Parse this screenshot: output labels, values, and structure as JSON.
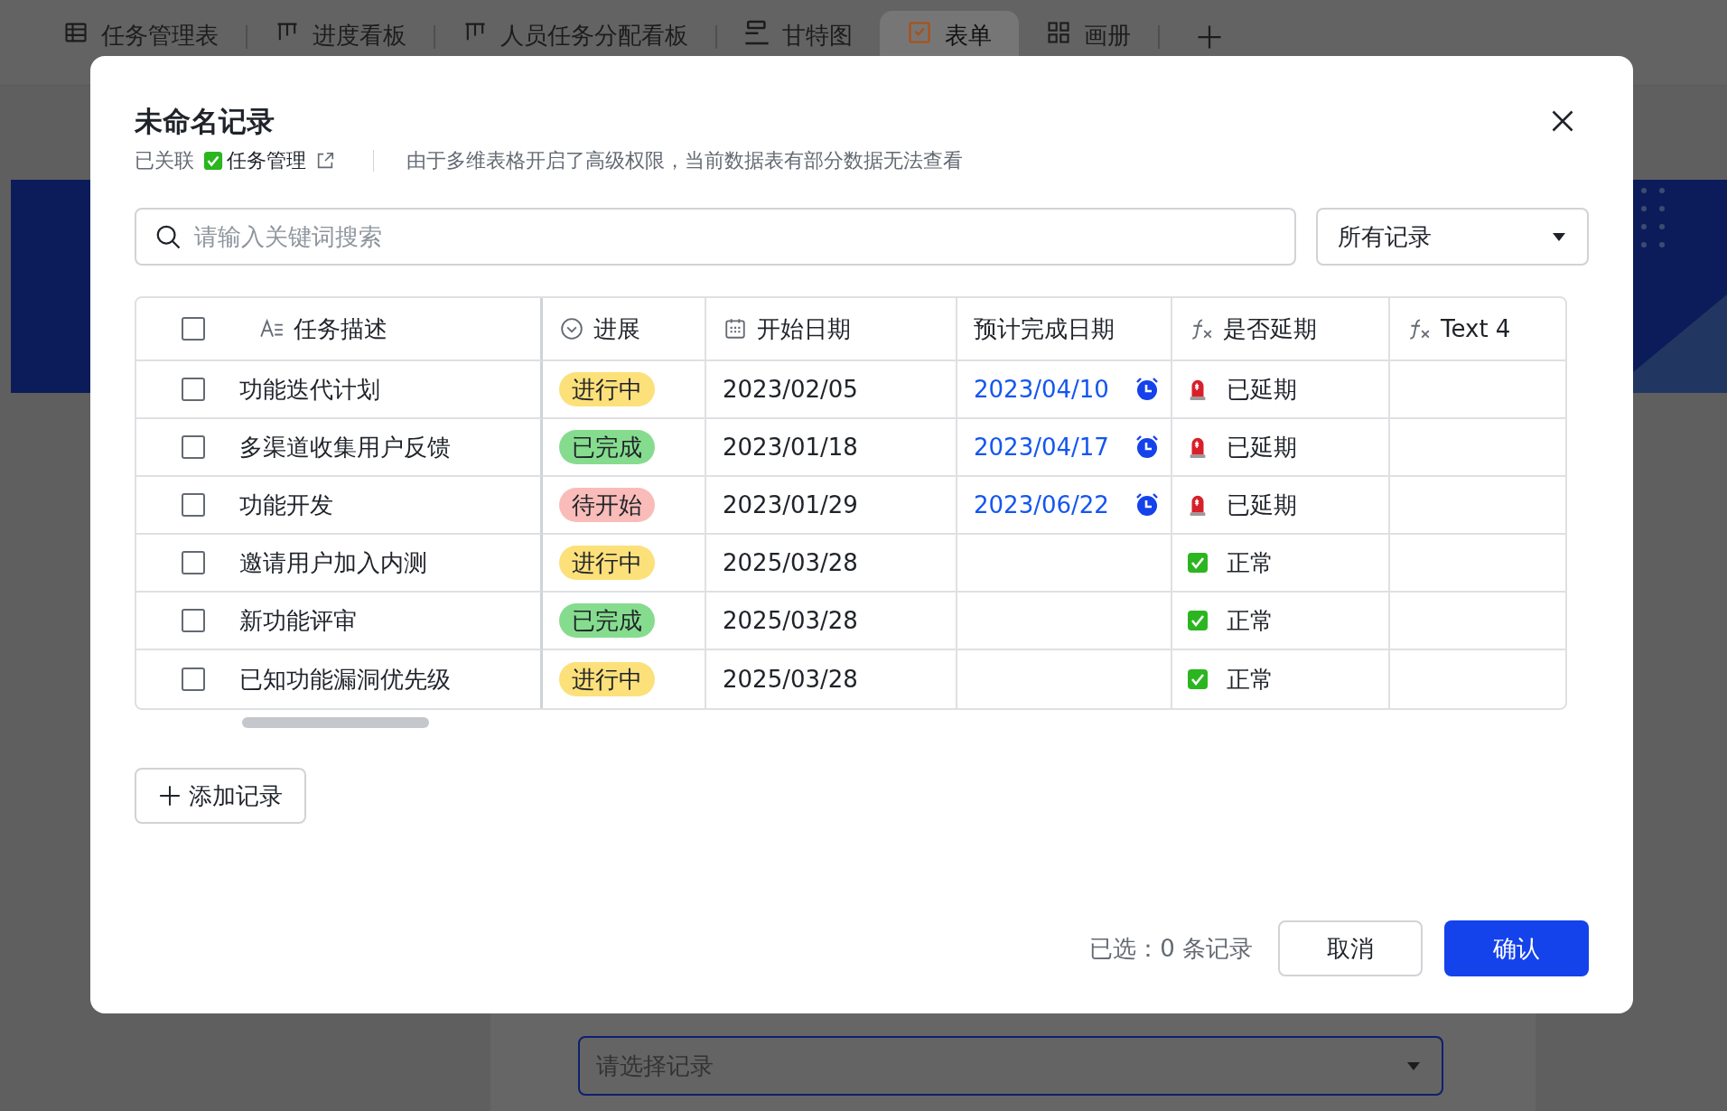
{
  "app_tabs": [
    {
      "label": "任务管理表",
      "kind": "grid",
      "selected": false
    },
    {
      "label": "进度看板",
      "kind": "kanban",
      "selected": false
    },
    {
      "label": "人员任务分配看板",
      "kind": "kanban",
      "selected": false
    },
    {
      "label": "甘特图",
      "kind": "gantt",
      "selected": false
    },
    {
      "label": "表单",
      "kind": "form",
      "selected": true
    },
    {
      "label": "画册",
      "kind": "gallery",
      "selected": false
    }
  ],
  "form_field": {
    "placeholder": "请选择记录"
  },
  "dialog": {
    "title": "未命名记录",
    "linked_label": "已关联",
    "linked_table": "任务管理",
    "notice": "由于多维表格开启了高级权限，当前数据表有部分数据无法查看",
    "search": {
      "placeholder": "请输入关键词搜索"
    },
    "filter": {
      "value": "所有记录"
    },
    "table": {
      "select_all": {
        "checked": false
      },
      "columns": [
        {
          "label": "任务描述",
          "kind": "text"
        },
        {
          "label": "进展",
          "kind": "select"
        },
        {
          "label": "开始日期",
          "kind": "date"
        },
        {
          "label": "预计完成日期",
          "kind": "plain"
        },
        {
          "label": "是否延期",
          "kind": "formula"
        },
        {
          "label": "Text 4",
          "kind": "formula"
        }
      ],
      "rows": [
        {
          "checked": false,
          "task": "功能迭代计划",
          "status": {
            "text": "进行中",
            "color": "#fce07a"
          },
          "start": "2023/02/05",
          "due": "2023/04/10",
          "delay": {
            "kind": "siren",
            "text": "已延期"
          }
        },
        {
          "checked": false,
          "task": "多渠道收集用户反馈",
          "status": {
            "text": "已完成",
            "color": "#86dc8e"
          },
          "start": "2023/01/18",
          "due": "2023/04/17",
          "delay": {
            "kind": "siren",
            "text": "已延期"
          }
        },
        {
          "checked": false,
          "task": "功能开发",
          "status": {
            "text": "待开始",
            "color": "#f9bcb8"
          },
          "start": "2023/01/29",
          "due": "2023/06/22",
          "delay": {
            "kind": "siren",
            "text": "已延期"
          }
        },
        {
          "checked": false,
          "task": "邀请用户加入内测",
          "status": {
            "text": "进行中",
            "color": "#fce07a"
          },
          "start": "2025/03/28",
          "delay": {
            "kind": "check",
            "text": "正常"
          }
        },
        {
          "checked": false,
          "task": "新功能评审",
          "status": {
            "text": "已完成",
            "color": "#86dc8e"
          },
          "start": "2025/03/28",
          "delay": {
            "kind": "check",
            "text": "正常"
          }
        },
        {
          "checked": false,
          "task": "已知功能漏洞优先级",
          "status": {
            "text": "进行中",
            "color": "#fce07a"
          },
          "start": "2025/03/28",
          "delay": {
            "kind": "check",
            "text": "正常"
          }
        }
      ]
    },
    "add_button": "添加记录",
    "selected_count": "已选：0 条记录",
    "cancel": "取消",
    "confirm": "确认"
  }
}
